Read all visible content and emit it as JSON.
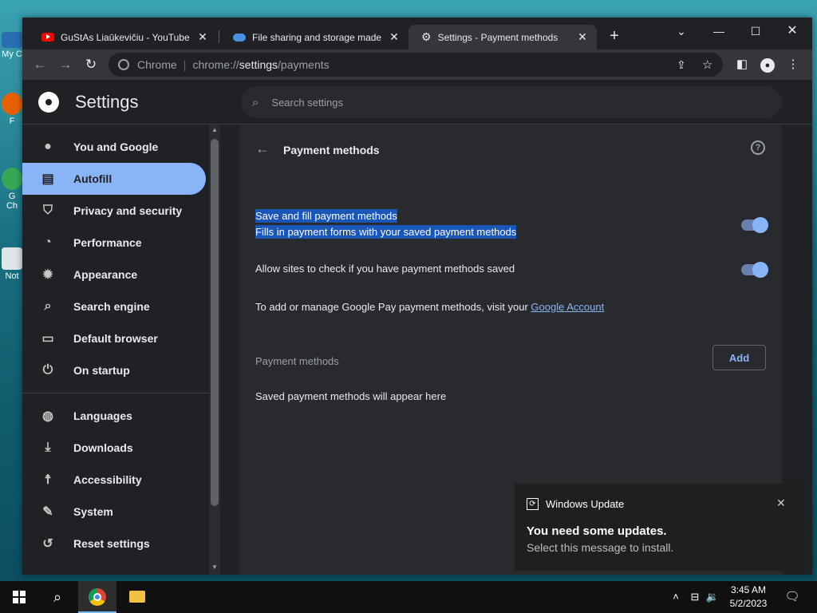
{
  "desktop": {
    "icons": [
      {
        "label": "My C"
      },
      {
        "label": "F"
      },
      {
        "label": "G\nCh"
      },
      {
        "label": "Not"
      }
    ]
  },
  "browser": {
    "tabs": [
      {
        "title": "GuStAs Liaūkevičiu - YouTube",
        "close": "✕"
      },
      {
        "title": "File sharing and storage made si",
        "close": "✕"
      },
      {
        "title": "Settings - Payment methods",
        "close": "✕"
      }
    ],
    "new_tab": "+",
    "omnibox": {
      "chip": "Chrome",
      "url_scheme": "chrome://",
      "url_host": "settings",
      "url_path": "/payments"
    }
  },
  "settings": {
    "title": "Settings",
    "search_placeholder": "Search settings",
    "sidebar": [
      {
        "label": "You and Google",
        "icon": "person-icon"
      },
      {
        "label": "Autofill",
        "icon": "clipboard-icon",
        "active": true
      },
      {
        "label": "Privacy and security",
        "icon": "shield-icon"
      },
      {
        "label": "Performance",
        "icon": "gauge-icon"
      },
      {
        "label": "Appearance",
        "icon": "palette-icon"
      },
      {
        "label": "Search engine",
        "icon": "search-icon"
      },
      {
        "label": "Default browser",
        "icon": "browser-icon"
      },
      {
        "label": "On startup",
        "icon": "power-icon"
      },
      {
        "label": "Languages",
        "icon": "globe-icon"
      },
      {
        "label": "Downloads",
        "icon": "download-icon"
      },
      {
        "label": "Accessibility",
        "icon": "accessibility-icon"
      },
      {
        "label": "System",
        "icon": "wrench-icon"
      },
      {
        "label": "Reset settings",
        "icon": "reset-icon"
      }
    ],
    "page": {
      "title": "Payment methods",
      "save_fill": {
        "title": "Save and fill payment methods",
        "subtitle": "Fills in payment forms with your saved payment methods",
        "enabled": true
      },
      "allow_sites": {
        "title": "Allow sites to check if you have payment methods saved",
        "enabled": true
      },
      "google_pay": {
        "text": "To add or manage Google Pay payment methods, visit your ",
        "link": "Google Account"
      },
      "section_label": "Payment methods",
      "add_label": "Add",
      "empty_text": "Saved payment methods will appear here"
    }
  },
  "notification": {
    "app": "Windows Update",
    "heading": "You need some updates.",
    "body": "Select this message to install.",
    "close": "✕"
  },
  "taskbar": {
    "time": "3:45 AM",
    "date": "5/2/2023"
  }
}
